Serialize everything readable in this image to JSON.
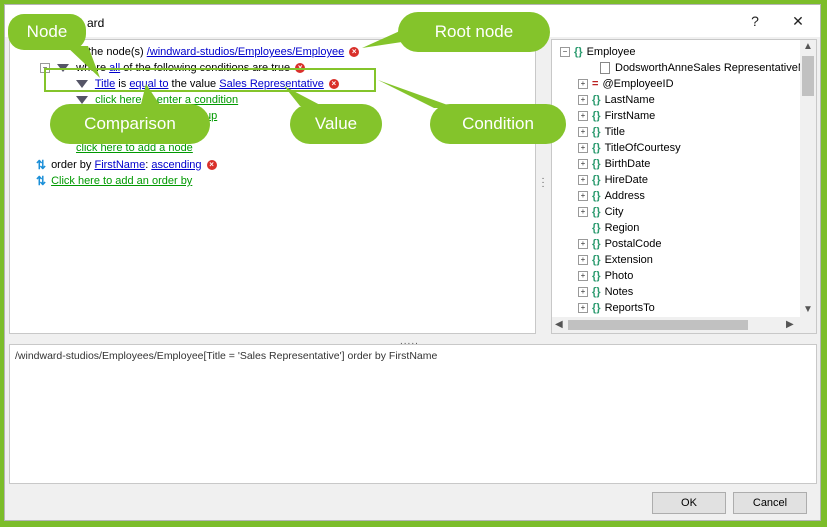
{
  "window": {
    "title": "ard",
    "help_label": "?",
    "close_label": "✕"
  },
  "query": {
    "select_text": "the node(s)",
    "root_path": "/windward-studios/Employees/Employee",
    "where_prefix": "where",
    "where_mode": "all",
    "where_suffix": "of the following conditions are true",
    "cond_field": "Title",
    "cond_is": "is",
    "cond_op": "equal to",
    "cond_value_prefix": "the value",
    "cond_value": "Sales Representative",
    "add_condition": "click here to enter a condition",
    "add_group": "up",
    "add_node": "click here to add a node",
    "order_prefix": "order by",
    "order_field": "FirstName",
    "order_colon": ":",
    "order_dir": "ascending",
    "add_order": "Click here to add an order by"
  },
  "xpath": "/windward-studios/Employees/Employee[Title = 'Sales Representative'] order by FirstName",
  "tree": {
    "root": "Employee",
    "sample": "DodsworthAnneSales RepresentativeM",
    "items": [
      "@EmployeeID",
      "LastName",
      "FirstName",
      "Title",
      "TitleOfCourtesy",
      "BirthDate",
      "HireDate",
      "Address",
      "City",
      "Region",
      "PostalCode",
      "Extension",
      "Photo",
      "Notes",
      "ReportsTo"
    ]
  },
  "buttons": {
    "ok": "OK",
    "cancel": "Cancel"
  },
  "callouts": {
    "node": "Node",
    "root_node": "Root node",
    "comparison": "Comparison",
    "value": "Value",
    "condition": "Condition"
  },
  "colors": {
    "accent": "#84c42b",
    "link": "#0000cc",
    "green_link": "#009900",
    "remove": "#d9302a"
  }
}
